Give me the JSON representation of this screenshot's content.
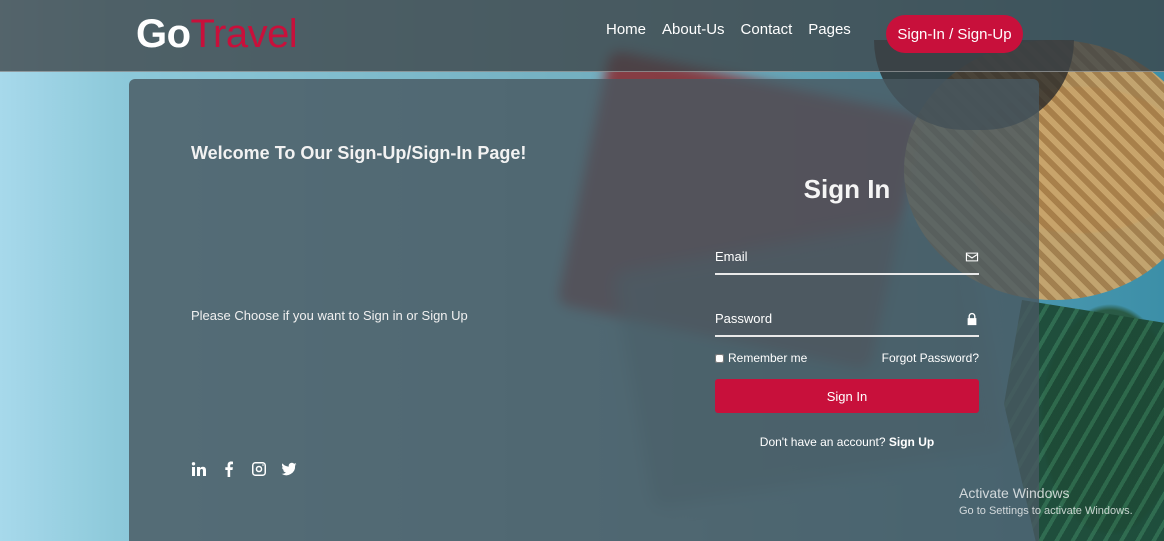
{
  "header": {
    "logo": {
      "part1": "Go",
      "part2": "Travel"
    },
    "nav": [
      "Home",
      "About-Us",
      "Contact",
      "Pages"
    ],
    "cta": "Sign-In / Sign-Up"
  },
  "left": {
    "welcome": "Welcome To Our Sign-Up/Sign-In Page!",
    "subtext": "Please Choose if you want to Sign in or Sign Up",
    "socials": [
      "linkedin-icon",
      "facebook-icon",
      "instagram-icon",
      "twitter-icon"
    ]
  },
  "form": {
    "title": "Sign In",
    "email_placeholder": "Email",
    "password_placeholder": "Password",
    "remember": "Remember me",
    "forgot": "Forgot Password?",
    "button": "Sign In",
    "account_text": "Don't have an account?",
    "signup_link": "Sign Up"
  },
  "watermark": {
    "line1": "Activate Windows",
    "line2": "Go to Settings to activate Windows."
  },
  "colors": {
    "accent": "#c8103b",
    "header_bg": "#3c4246",
    "card_bg": "#485860"
  }
}
